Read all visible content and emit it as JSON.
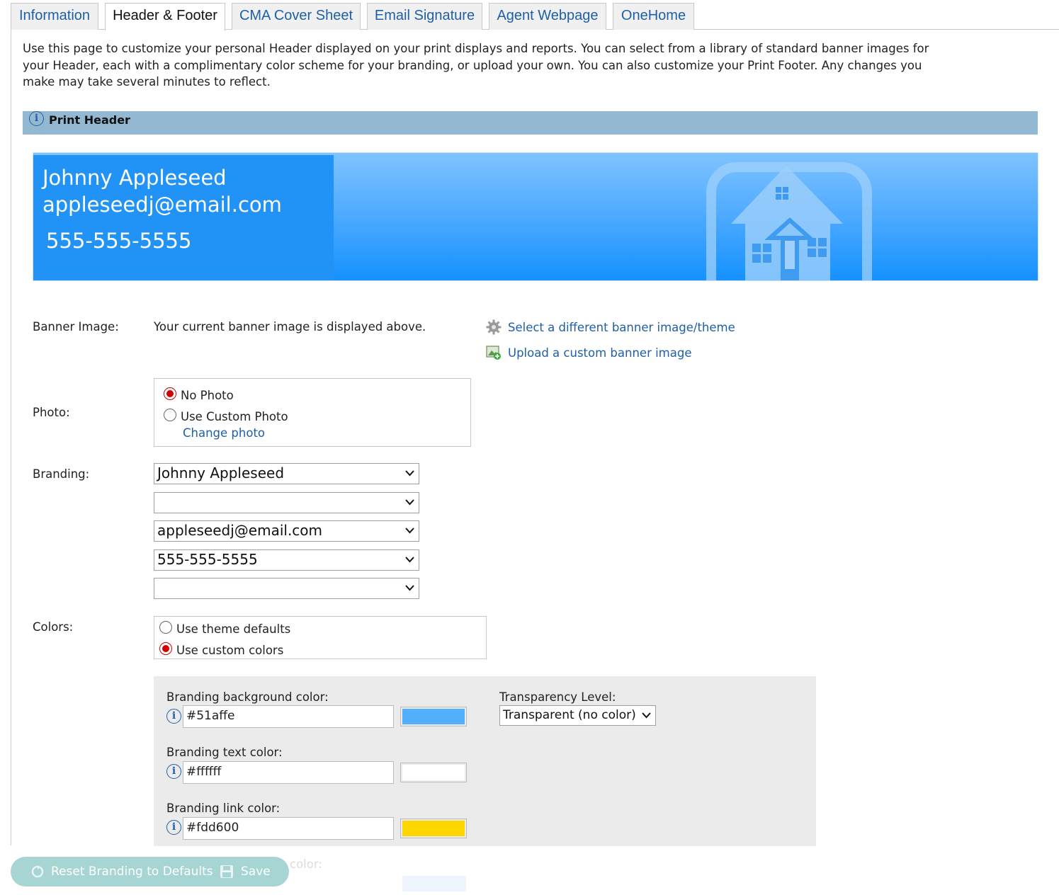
{
  "tabs": [
    {
      "label": "Information",
      "active": false
    },
    {
      "label": "Header & Footer",
      "active": true
    },
    {
      "label": "CMA Cover Sheet",
      "active": false
    },
    {
      "label": "Email Signature",
      "active": false
    },
    {
      "label": "Agent Webpage",
      "active": false
    },
    {
      "label": "OneHome",
      "active": false
    }
  ],
  "intro": "Use this page to customize your personal Header displayed on your print displays and reports. You can select from a library of standard banner images for your Header, each with a complimentary color scheme for your branding, or upload your own. You can also customize your Print Footer. Any changes you make may take several minutes to reflect.",
  "section": {
    "title": "Print Header",
    "icon": "info-icon"
  },
  "banner": {
    "name": "Johnny Appleseed",
    "email": "appleseedj@email.com",
    "phone": "555-555-5555",
    "icon": "house-icon"
  },
  "banner_image": {
    "label": "Banner Image:",
    "description": "Your current banner image is displayed above.",
    "select_link": "Select a different banner image/theme",
    "upload_link": "Upload a custom banner image"
  },
  "photo": {
    "label": "Photo:",
    "options": [
      {
        "label": "No Photo",
        "selected": true
      },
      {
        "label": "Use Custom Photo",
        "selected": false
      }
    ],
    "change_link": "Change photo"
  },
  "branding": {
    "label": "Branding:",
    "selects": [
      "Johnny Appleseed",
      "",
      "appleseedj@email.com",
      "555-555-5555",
      ""
    ]
  },
  "colors": {
    "label": "Colors:",
    "options": [
      {
        "label": "Use theme defaults",
        "selected": false
      },
      {
        "label": "Use custom colors",
        "selected": true
      }
    ],
    "bg_label": "Branding background color:",
    "bg_value": "#51affe",
    "text_label": "Branding text color:",
    "text_value": "#ffffff",
    "link_label": "Branding link color:",
    "link_value": "#fdd600",
    "partial_label": "color:",
    "transparency_label": "Transparency Level:",
    "transparency_value": "Transparent (no color)"
  },
  "footer": {
    "reset_label": "Reset Branding to Defaults",
    "save_label": "Save"
  }
}
